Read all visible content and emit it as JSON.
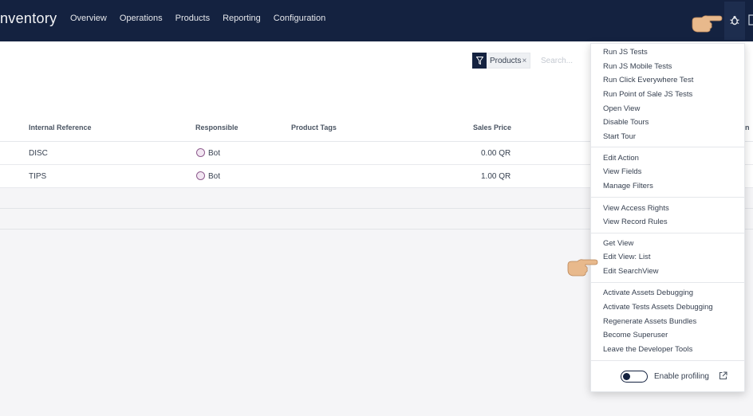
{
  "topbar": {
    "app_title": "nventory",
    "nav": [
      "Overview",
      "Operations",
      "Products",
      "Reporting",
      "Configuration"
    ]
  },
  "search": {
    "facet_label": "Products",
    "facet_remove": "×",
    "placeholder": "Search..."
  },
  "table": {
    "headers": {
      "internal_reference": "Internal Reference",
      "responsible": "Responsible",
      "product_tags": "Product Tags",
      "sales_price": "Sales Price",
      "cut": "n"
    },
    "rows": [
      {
        "internal_reference": "DISC",
        "responsible": "Bot",
        "sales_price": "0.00 QR"
      },
      {
        "internal_reference": "TIPS",
        "responsible": "Bot",
        "sales_price": "1.00 QR"
      }
    ]
  },
  "debug_menu": {
    "group_tests": [
      "Run JS Tests",
      "Run JS Mobile Tests",
      "Run Click Everywhere Test",
      "Run Point of Sale JS Tests",
      "Open View",
      "Disable Tours",
      "Start Tour"
    ],
    "group_action": [
      "Edit Action",
      "View Fields",
      "Manage Filters"
    ],
    "group_access": [
      "View Access Rights",
      "View Record Rules"
    ],
    "group_view": [
      "Get View",
      "Edit View: List",
      "Edit SearchView"
    ],
    "group_assets": [
      "Activate Assets Debugging",
      "Activate Tests Assets Debugging",
      "Regenerate Assets Bundles",
      "Become Superuser",
      "Leave the Developer Tools"
    ],
    "profiling_label": "Enable profiling"
  },
  "colors": {
    "navbar": "#142240",
    "avatar_border": "#8e5c8e"
  },
  "icons": {
    "debug": "bug-icon",
    "facet": "filter-icon",
    "external": "external-link-icon",
    "pointer": "pointing-hand-icon"
  }
}
